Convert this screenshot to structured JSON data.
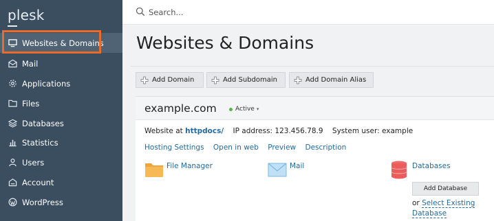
{
  "sidebar": {
    "logo": "plesk",
    "items": [
      {
        "label": "Websites & Domains",
        "icon": "monitor-icon"
      },
      {
        "label": "Mail",
        "icon": "mail-icon"
      },
      {
        "label": "Applications",
        "icon": "gear-icon"
      },
      {
        "label": "Files",
        "icon": "folder-icon"
      },
      {
        "label": "Databases",
        "icon": "layers-icon"
      },
      {
        "label": "Statistics",
        "icon": "bar-chart-icon"
      },
      {
        "label": "Users",
        "icon": "user-icon"
      },
      {
        "label": "Account",
        "icon": "account-icon"
      },
      {
        "label": "WordPress",
        "icon": "wordpress-icon"
      }
    ],
    "collapse_glyph": "‹"
  },
  "search": {
    "placeholder": "Search..."
  },
  "main": {
    "title": "Websites & Domains",
    "toolbar": [
      "Add Domain",
      "Add Subdomain",
      "Add Domain Alias"
    ]
  },
  "domain": {
    "name": "example.com",
    "status": "Active",
    "website_at_label": "Website at",
    "docroot": "httpdocs/",
    "ip_label": "IP address:",
    "ip": "123.456.78.9",
    "user_label": "System user:",
    "user": "example",
    "links": [
      "Hosting Settings",
      "Open in web",
      "Preview",
      "Description"
    ],
    "tools": {
      "file_manager": "File Manager",
      "mail": "Mail",
      "databases": "Databases"
    },
    "add_database": "Add Database",
    "or_text": "or",
    "select_existing": "Select Existing Database"
  },
  "colors": {
    "sidebar_bg": "#3b4e60",
    "highlight": "#ee6a2a",
    "link": "#256a9e",
    "status_active": "#55b447"
  }
}
